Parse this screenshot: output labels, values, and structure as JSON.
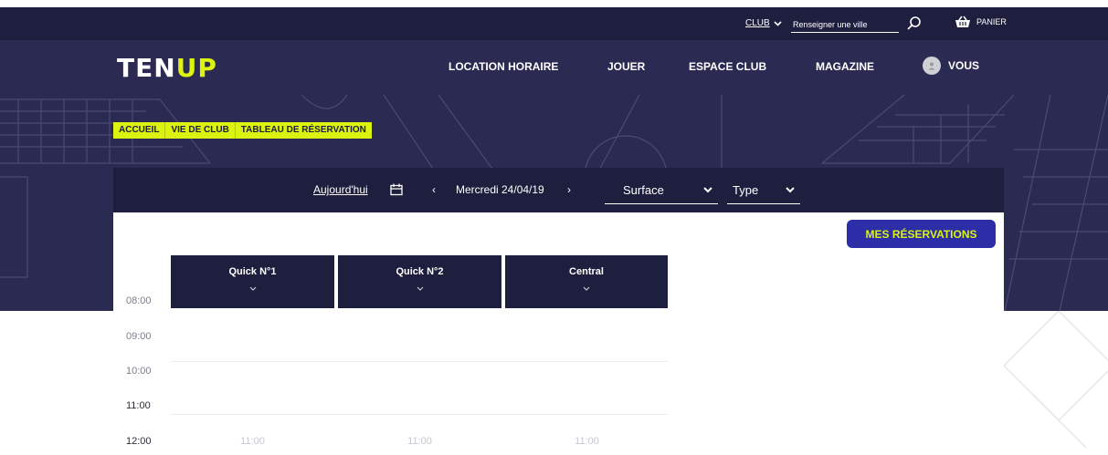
{
  "utility": {
    "club_label": "CLUB",
    "city_placeholder": "Renseigner une ville",
    "cart_label": "PANIER"
  },
  "brand": {
    "logo_ten": "TEN",
    "logo_up": "UP"
  },
  "nav": {
    "items": [
      "LOCATION HORAIRE",
      "JOUER",
      "ESPACE CLUB",
      "MAGAZINE"
    ],
    "user": "VOUS"
  },
  "breadcrumb": [
    "ACCUEIL",
    "VIE DE CLUB",
    "TABLEAU DE RÉSERVATION"
  ],
  "filters": {
    "today": "Aujourd'hui",
    "prev": "‹",
    "date": "Mercredi 24/04/19",
    "next": "›",
    "surface": "Surface",
    "type": "Type"
  },
  "actions": {
    "my_reservations": "MES RÉSERVATIONS"
  },
  "courts": [
    {
      "name": "Quick N°1"
    },
    {
      "name": "Quick N°2"
    },
    {
      "name": "Central"
    }
  ],
  "hours": [
    "08:00",
    "09:00",
    "10:00",
    "11:00",
    "12:00"
  ],
  "slots": [
    "11:00",
    "11:00",
    "11:00"
  ],
  "colors": {
    "navy": "#1e1e3f",
    "hero": "#2b2a52",
    "accent": "#dcf20f",
    "button": "#2c2ea8"
  }
}
